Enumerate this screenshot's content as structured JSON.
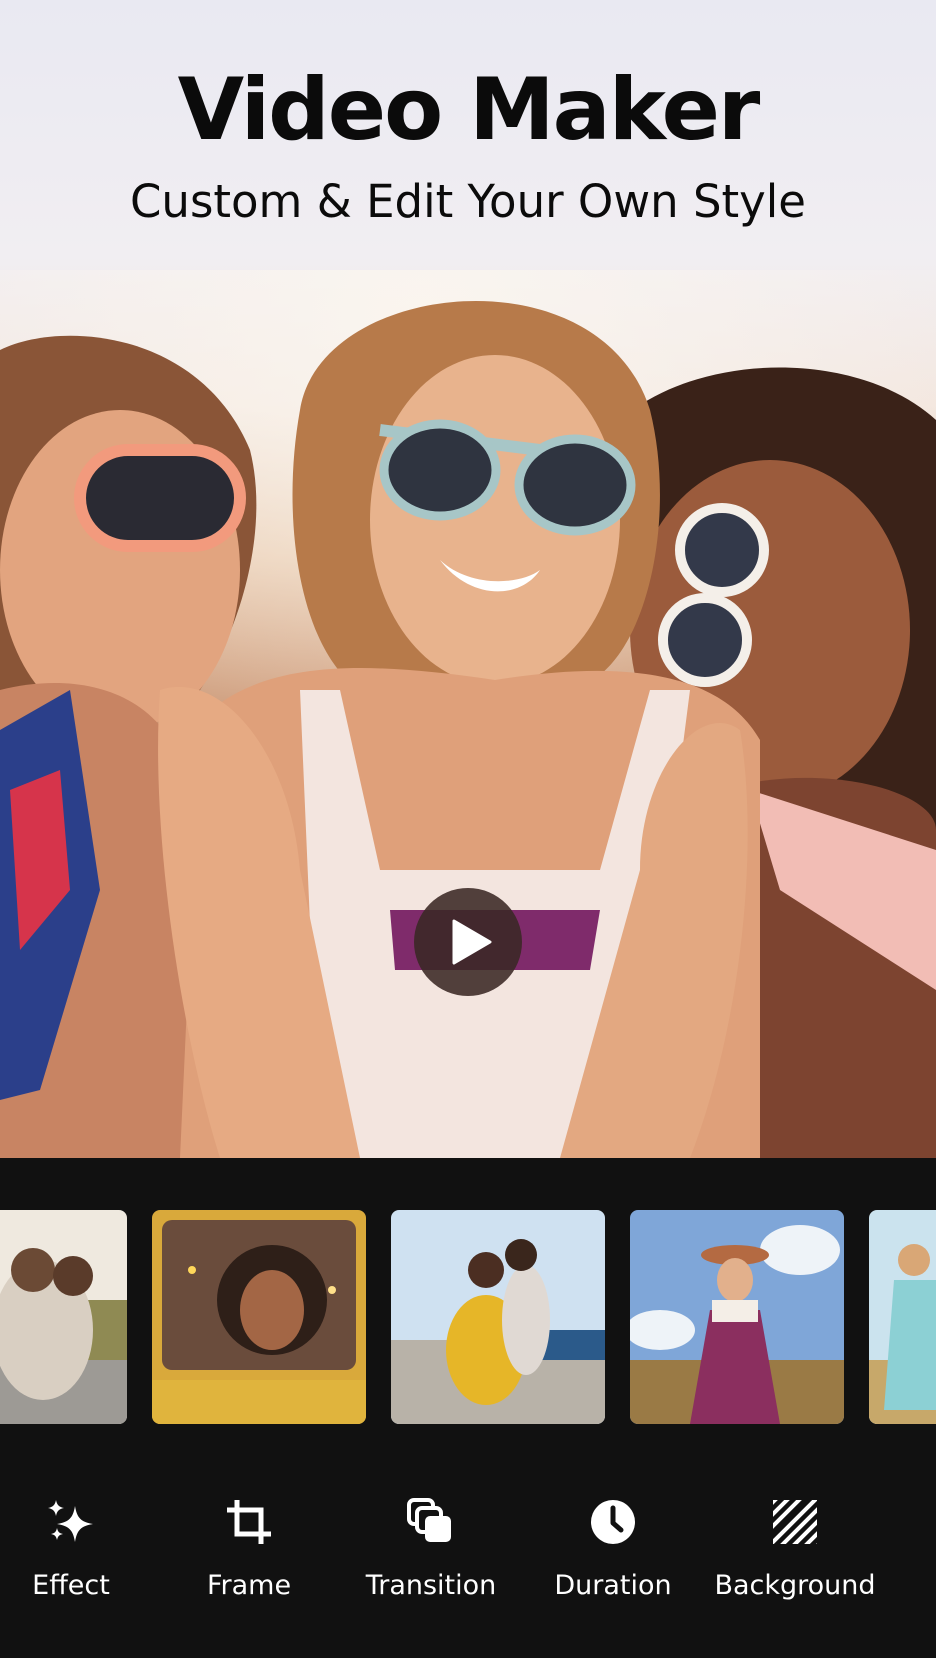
{
  "header": {
    "title": "Video Maker",
    "subtitle": "Custom &  Edit Your Own Style"
  },
  "preview": {
    "play_icon": "play-icon"
  },
  "thumbnails": [
    {
      "name": "couple-car"
    },
    {
      "name": "woman-jeep-confetti"
    },
    {
      "name": "friends-yellow-outfit"
    },
    {
      "name": "woman-hat-field"
    },
    {
      "name": "woman-blue-dress"
    }
  ],
  "toolbar": {
    "tools": [
      {
        "label": "Effect",
        "icon": "sparkle-icon"
      },
      {
        "label": "Frame",
        "icon": "crop-icon"
      },
      {
        "label": "Transition",
        "icon": "layers-icon"
      },
      {
        "label": "Duration",
        "icon": "clock-icon"
      },
      {
        "label": "Background",
        "icon": "stripes-icon"
      }
    ]
  },
  "colors": {
    "toolbar_bg": "#111111",
    "title_text": "#0b0b0b",
    "tool_label": "#ffffff"
  }
}
